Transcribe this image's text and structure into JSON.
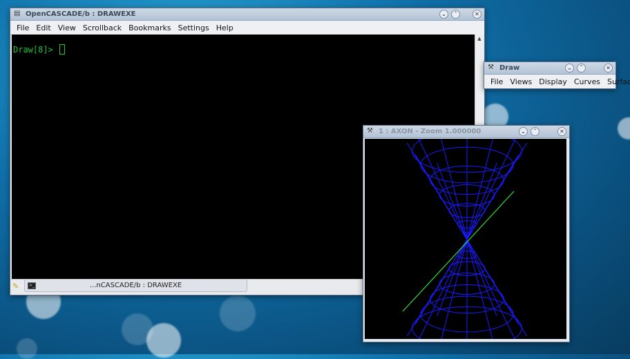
{
  "terminal": {
    "title": "OpenCASCADE/b : DRAWEXE",
    "menu": [
      "File",
      "Edit",
      "View",
      "Scrollback",
      "Bookmarks",
      "Settings",
      "Help"
    ],
    "prompt": "Draw[8]> ",
    "tab_label": "...nCASCADE/b : DRAWEXE",
    "text_color": "#26c23a"
  },
  "draw_window": {
    "title": "Draw",
    "menu": [
      "File",
      "Views",
      "Display",
      "Curves",
      "Surfaces"
    ]
  },
  "viewer": {
    "title": "1 : AXON - Zoom 1.000000",
    "wire_color": "#1a1aff",
    "line_color": "#30e040"
  },
  "icons": {
    "window_controls": [
      "minimize-icon",
      "maximize-icon",
      "close-icon"
    ]
  }
}
